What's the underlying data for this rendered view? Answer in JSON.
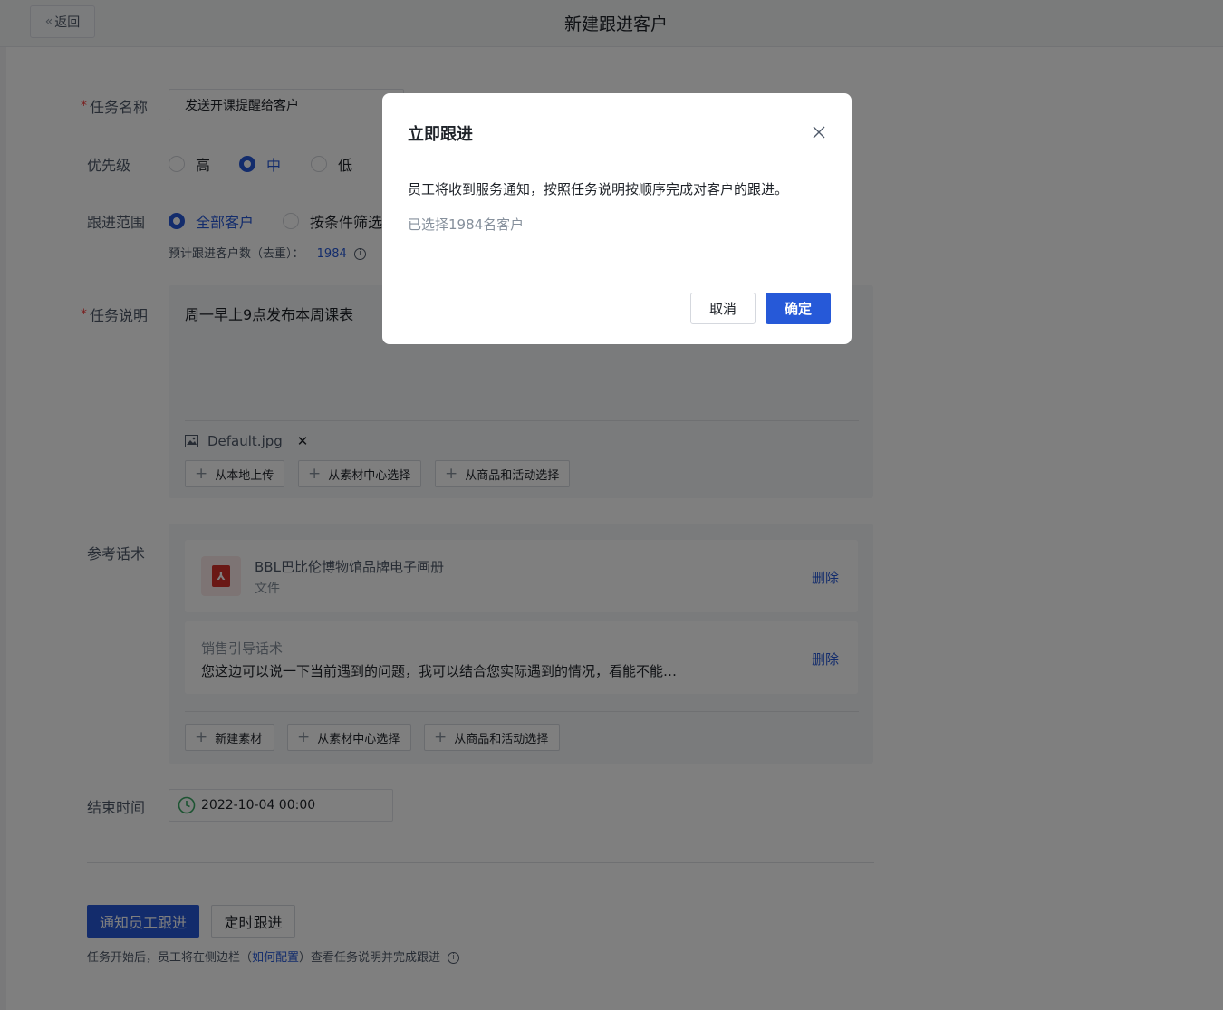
{
  "header": {
    "back_label": "返回",
    "title": "新建跟进客户"
  },
  "form": {
    "task_name": {
      "label": "任务名称",
      "required": true,
      "value": "发送开课提醒给客户"
    },
    "priority": {
      "label": "优先级",
      "options": [
        "高",
        "中",
        "低"
      ],
      "selected": "中"
    },
    "scope": {
      "label": "跟进范围",
      "options": [
        "全部客户",
        "按条件筛选"
      ],
      "selected": "全部客户",
      "estimate_label": "预计跟进客户数（去重）：",
      "estimate_value": "1984"
    },
    "description": {
      "label": "任务说明",
      "required": true,
      "value": "周一早上9点发布本周课表",
      "attachment": "Default.jpg",
      "buttons": [
        "从本地上传",
        "从素材中心选择",
        "从商品和活动选择"
      ]
    },
    "reference": {
      "label": "参考话术",
      "items": [
        {
          "title": "BBL巴比伦博物馆品牌电子画册",
          "subtitle": "文件",
          "action": "删除"
        },
        {
          "title": "销售引导话术",
          "content": "您这边可以说一下当前遇到的问题，我可以结合您实际遇到的情况，看能不能…",
          "action": "删除"
        }
      ],
      "buttons": [
        "新建素材",
        "从素材中心选择",
        "从商品和活动选择"
      ]
    },
    "end_time": {
      "label": "结束时间",
      "value": "2022-10-04 00:00"
    }
  },
  "footer": {
    "primary_label": "通知员工跟进",
    "secondary_label": "定时跟进",
    "hint_before": "任务开始后，员工将在侧边栏（",
    "hint_link": "如何配置",
    "hint_after": "）查看任务说明并完成跟进"
  },
  "modal": {
    "title": "立即跟进",
    "message": "员工将收到服务通知，按照任务说明按顺序完成对客户的跟进。",
    "selected_count": "已选择1984名客户",
    "cancel_label": "取消",
    "confirm_label": "确定"
  },
  "colors": {
    "primary": "#2659d8",
    "required": "#f53f3f",
    "overlay": "rgba(0,0,0,0.5)",
    "pdf_icon": "#d4302b"
  }
}
